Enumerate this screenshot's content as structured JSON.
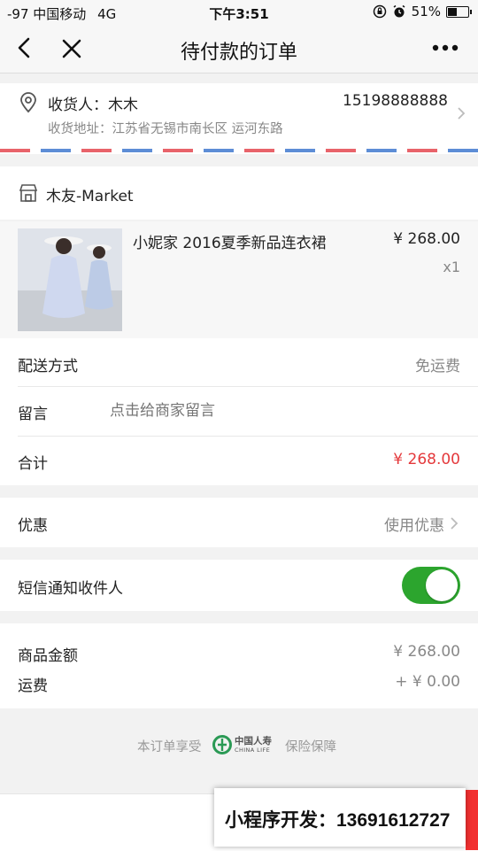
{
  "status_bar": {
    "carrier": "-97 中国移动",
    "network": "4G",
    "time": "下午3:51",
    "battery_text": "51%",
    "battery_level": 0.51
  },
  "nav": {
    "title": "待付款的订单"
  },
  "address": {
    "recipient_label": "收货人：",
    "recipient_name": "木木",
    "phone": "15198888888",
    "address_text": "收货地址：江苏省无锡市南长区 运河东路"
  },
  "shop": {
    "name": "木友-Market",
    "product": {
      "title": "小妮家 2016夏季新品连衣裙",
      "price": "¥ 268.00",
      "qty": "x1"
    }
  },
  "order": {
    "delivery_label": "配送方式",
    "delivery_value": "免运费",
    "message_label": "留言",
    "message_placeholder": "点击给商家留言",
    "total_label": "合计",
    "total_value": "¥ 268.00"
  },
  "discount": {
    "label": "优惠",
    "action": "使用优惠"
  },
  "sms": {
    "label": "短信通知收件人",
    "enabled": true
  },
  "summary": {
    "goods_label": "商品金额",
    "goods_value": "¥ 268.00",
    "shipping_label": "运费",
    "shipping_value": "+ ¥ 0.00"
  },
  "insurance": {
    "prefix": "本订单享受",
    "logo_cn": "中国人寿",
    "logo_en": "CHINA LIFE",
    "suffix": "保险保障"
  },
  "promo_banner": {
    "text": "小程序开发：13691612727"
  },
  "colors": {
    "accent_red": "#e4393c",
    "toggle_green": "#2ca52e",
    "airmail_red": "#e8636a",
    "airmail_blue": "#5d8dd6"
  }
}
